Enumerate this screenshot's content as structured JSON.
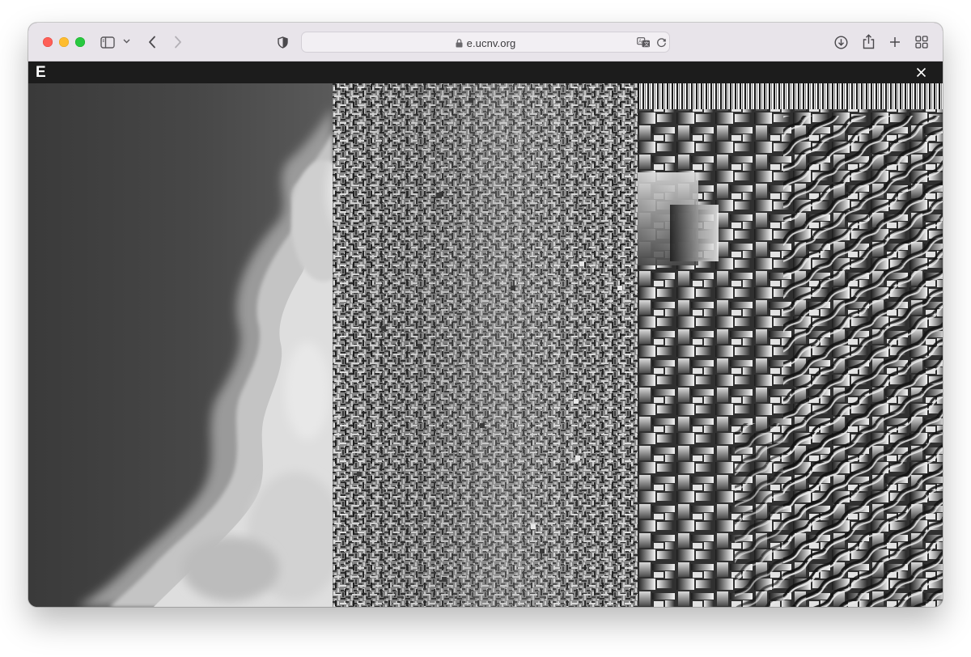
{
  "browser": {
    "url": "e.ucnv.org",
    "icons": [
      "sidebar-icon",
      "chevron-down-icon",
      "back-icon",
      "forward-icon",
      "shield-icon",
      "lock-icon",
      "translate-icon",
      "reload-icon",
      "download-icon",
      "share-icon",
      "new-tab-icon",
      "tab-overview-icon"
    ]
  },
  "app": {
    "logo": "E",
    "close_icon": "close-icon"
  },
  "panels": [
    {
      "name": "cloud-photo"
    },
    {
      "name": "glitched-texture"
    },
    {
      "name": "block-glitch"
    }
  ]
}
